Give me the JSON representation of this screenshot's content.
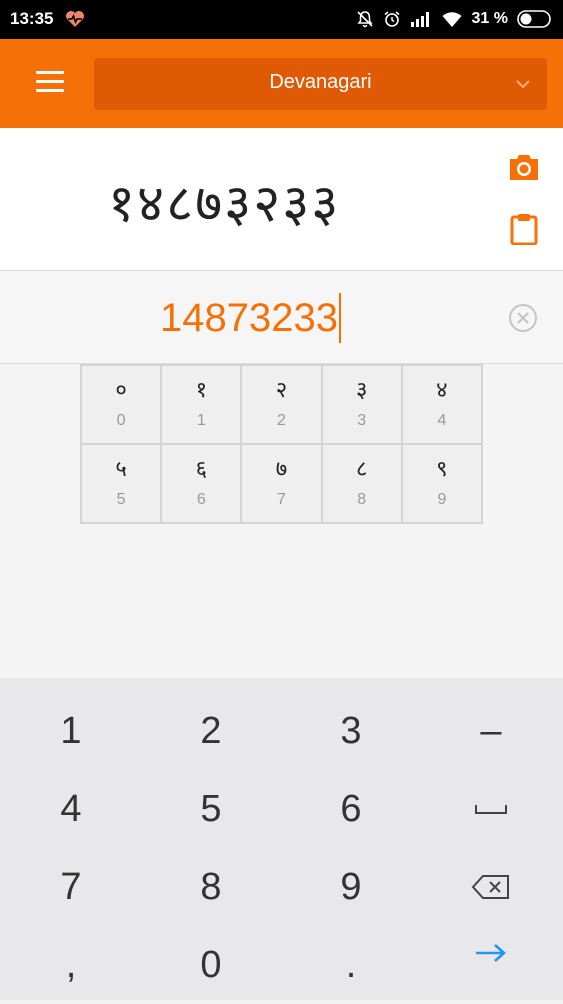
{
  "status_bar": {
    "time": "13:35",
    "battery": "31 %"
  },
  "app_bar": {
    "script_selector": "Devanagari"
  },
  "output": {
    "text": "१४८७३२३३"
  },
  "input": {
    "value": "14873233"
  },
  "digit_table": [
    {
      "devanagari": "०",
      "arabic": "0"
    },
    {
      "devanagari": "१",
      "arabic": "1"
    },
    {
      "devanagari": "२",
      "arabic": "2"
    },
    {
      "devanagari": "३",
      "arabic": "3"
    },
    {
      "devanagari": "४",
      "arabic": "4"
    },
    {
      "devanagari": "५",
      "arabic": "5"
    },
    {
      "devanagari": "६",
      "arabic": "6"
    },
    {
      "devanagari": "७",
      "arabic": "7"
    },
    {
      "devanagari": "८",
      "arabic": "8"
    },
    {
      "devanagari": "९",
      "arabic": "9"
    }
  ],
  "keyboard": {
    "k1": "1",
    "k2": "2",
    "k3": "3",
    "minus": "–",
    "k4": "4",
    "k5": "5",
    "k6": "6",
    "k7": "7",
    "k8": "8",
    "k9": "9",
    "comma": ",",
    "k0": "0",
    "dot": "."
  },
  "colors": {
    "accent": "#f57107",
    "accent_dark": "#e05a06",
    "enter_arrow": "#2196f3"
  },
  "icons": [
    "heart-rate-icon",
    "silent-icon",
    "alarm-icon",
    "signal-icon",
    "wifi-icon",
    "battery-icon",
    "menu-icon",
    "chevron-down-icon",
    "camera-icon",
    "clipboard-icon",
    "clear-icon",
    "space-icon",
    "backspace-icon",
    "enter-arrow-icon"
  ]
}
